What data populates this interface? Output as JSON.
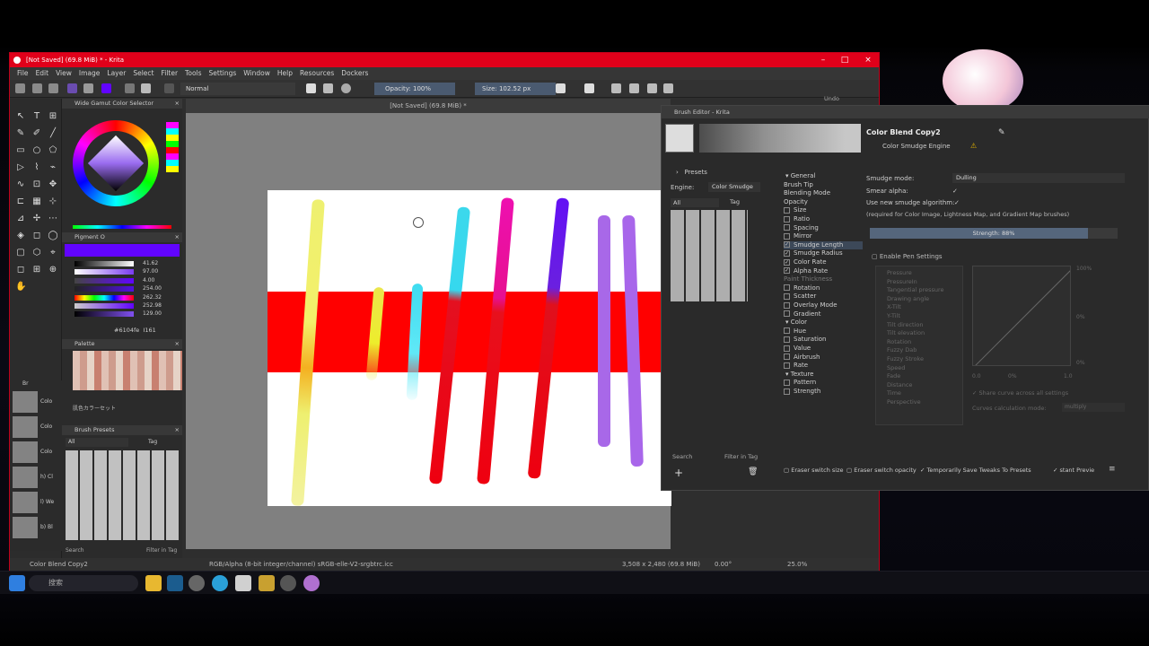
{
  "window": {
    "title": "[Not Saved]  (69.8 MiB) * - Krita"
  },
  "menu": [
    "File",
    "Edit",
    "View",
    "Image",
    "Layer",
    "Select",
    "Filter",
    "Tools",
    "Settings",
    "Window",
    "Help",
    "Resources",
    "Dockers"
  ],
  "toolbar": {
    "blend_mode": "Normal",
    "opacity": "Opacity: 100%",
    "size": "Size: 102.52 px"
  },
  "canvas_tab": "[Not Saved]  (69.8 MiB) *",
  "dockers": {
    "color_selector": "Wide Gamut Color Selector",
    "pigment": {
      "title": "Pigment O",
      "values": [
        "41.62",
        "97.00",
        "4.00",
        "254.00",
        "262.32",
        "252.98",
        "129.00"
      ],
      "hex": "#6104fe",
      "hex_extra": "I161"
    },
    "palette": {
      "title": "Palette",
      "name": "肌色カラーセット"
    },
    "brush_presets": {
      "title": "Brush Presets",
      "filter": "All",
      "tag": "Tag",
      "search": "Search",
      "filter_in_tag": "Filter in Tag"
    }
  },
  "right_tabs": [
    "Undo"
  ],
  "left_strip": {
    "title": "Br",
    "items": [
      "Colo",
      "Colo",
      "Colo",
      "h) Cl",
      "l) We",
      "b) Bl"
    ]
  },
  "status": {
    "preset": "Color Blend Copy2",
    "colorspace": "RGB/Alpha (8-bit integer/channel)  sRGB-elle-V2-srgbtrc.icc",
    "dimensions": "3,508 x 2,480 (69.8 MiB)",
    "rotation": "0.00°",
    "zoom": "25.0%"
  },
  "brush_editor": {
    "title": "Brush Editor - Krita",
    "preset_name": "Color Blend Copy2",
    "engine_label": "Color Smudge Engine",
    "presets_label": "Presets",
    "engine_field_label": "Engine:",
    "engine_value": "Color Smudge",
    "list_filter": "All",
    "tag": "Tag",
    "search": "Search",
    "filter_in_tag": "Filter in Tag",
    "options": [
      {
        "label": "General",
        "kind": "head"
      },
      {
        "label": "Brush Tip",
        "kind": "plain"
      },
      {
        "label": "Blending Mode",
        "kind": "plain"
      },
      {
        "label": "Opacity",
        "kind": "plain"
      },
      {
        "label": "Size",
        "kind": "cb",
        "checked": false
      },
      {
        "label": "Ratio",
        "kind": "cb",
        "checked": false
      },
      {
        "label": "Spacing",
        "kind": "cb",
        "checked": false
      },
      {
        "label": "Mirror",
        "kind": "cb",
        "checked": false
      },
      {
        "label": "Smudge Length",
        "kind": "cb",
        "checked": true,
        "selected": true
      },
      {
        "label": "Smudge Radius",
        "kind": "cb",
        "checked": true
      },
      {
        "label": "Color Rate",
        "kind": "cb",
        "checked": true
      },
      {
        "label": "Alpha Rate",
        "kind": "cb",
        "checked": true
      },
      {
        "label": "Paint Thickness",
        "kind": "dim"
      },
      {
        "label": "Rotation",
        "kind": "cb",
        "checked": false
      },
      {
        "label": "Scatter",
        "kind": "cb",
        "checked": false
      },
      {
        "label": "Overlay Mode",
        "kind": "cb",
        "checked": false
      },
      {
        "label": "Gradient",
        "kind": "cb",
        "checked": false
      },
      {
        "label": "Color",
        "kind": "head"
      },
      {
        "label": "Hue",
        "kind": "cb",
        "checked": false
      },
      {
        "label": "Saturation",
        "kind": "cb",
        "checked": false
      },
      {
        "label": "Value",
        "kind": "cb",
        "checked": false
      },
      {
        "label": "Airbrush",
        "kind": "cb",
        "checked": false
      },
      {
        "label": "Rate",
        "kind": "cb",
        "checked": false
      },
      {
        "label": "Texture",
        "kind": "head"
      },
      {
        "label": "Pattern",
        "kind": "cb",
        "checked": false
      },
      {
        "label": "Strength",
        "kind": "cb",
        "checked": false
      }
    ],
    "smudge_mode_label": "Smudge mode:",
    "smudge_mode_value": "Dulling",
    "smear_alpha": "Smear alpha:",
    "new_algorithm": "Use new smudge algorithm:",
    "note": "(required for Color Image, Lightness Map, and Gradient Map brushes)",
    "strength": "Strength: 88%",
    "strength_value": 0.88,
    "enable_pen": "Enable Pen Settings",
    "sensors": [
      "Pressure",
      "PressureIn",
      "Tangential pressure",
      "Drawing angle",
      "X-Tilt",
      "Y-Tilt",
      "Tilt direction",
      "Tilt elevation",
      "Rotation",
      "Fuzzy Dab",
      "Fuzzy Stroke",
      "Speed",
      "Fade",
      "Distance",
      "Time",
      "Perspective"
    ],
    "curve_top": "100%",
    "curve_mid": "0%",
    "curve_bottom": "0%",
    "curve_x0": "0.0",
    "curve_x1": "1.0",
    "curve_field": "0%",
    "share_curve": "Share curve across all settings",
    "curves_calc": "Curves calculation mode:",
    "curves_calc_value": "multiply",
    "eraser_size": "Eraser switch size",
    "eraser_opacity": "Eraser switch opacity",
    "temp_save": "Temporarily Save Tweaks To Presets",
    "instant_preview": "stant Previe"
  },
  "taskbar": {
    "search": "搜索"
  },
  "colors": {
    "title_red": "#e0001a",
    "stripe_red": "#ff0000",
    "foreground": "#6104fe"
  }
}
